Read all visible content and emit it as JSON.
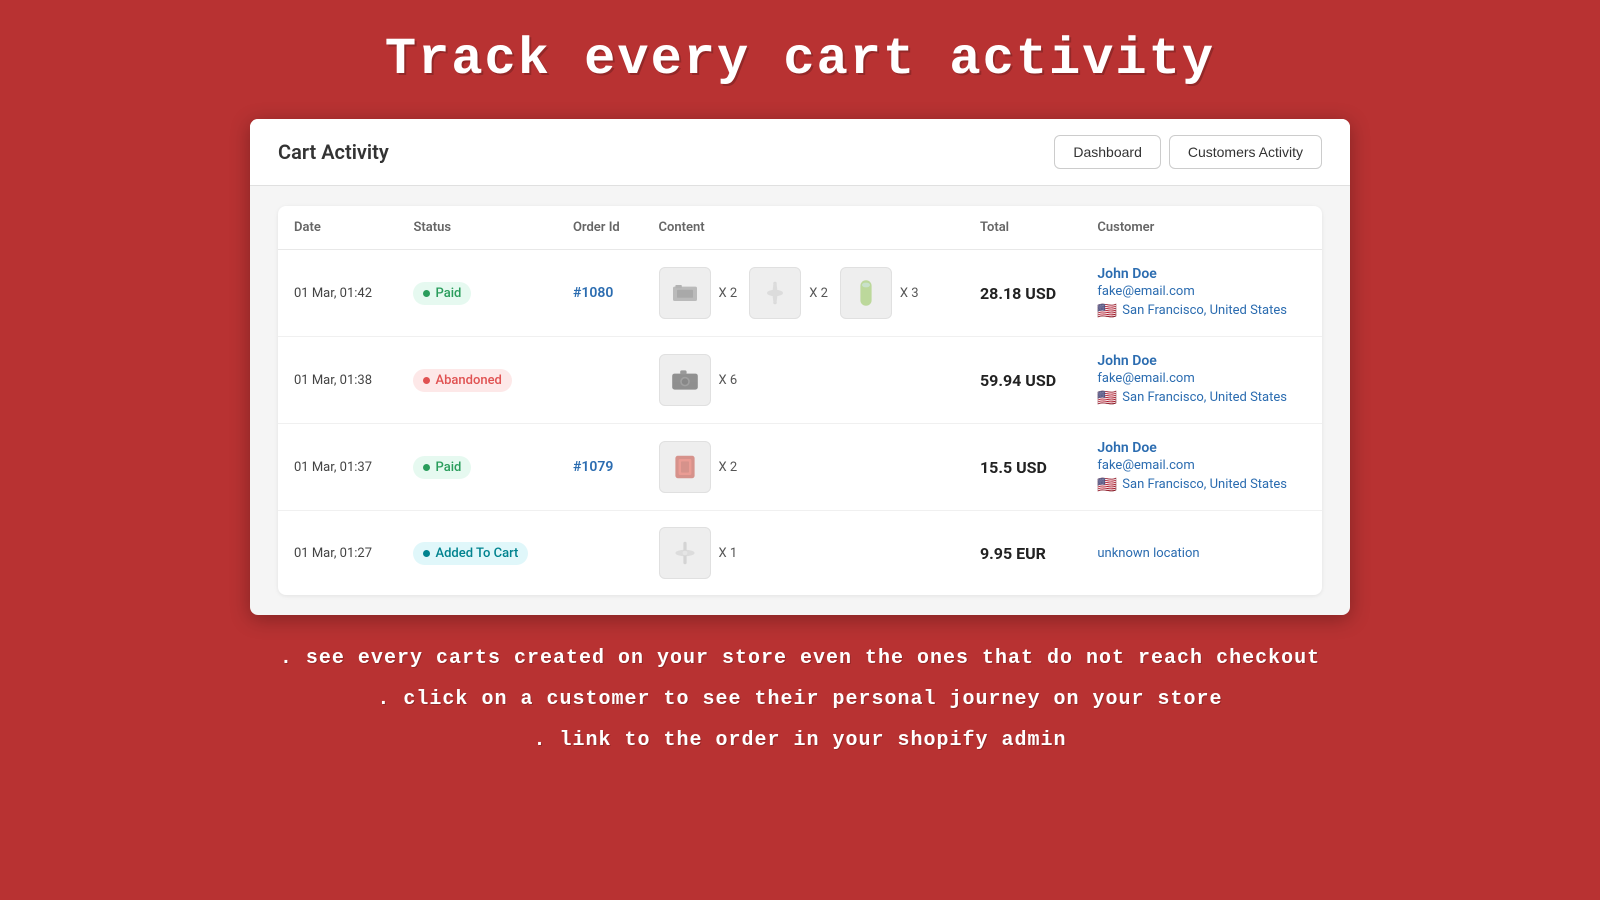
{
  "hero": {
    "title": "Track every cart activity"
  },
  "app": {
    "title": "Cart Activity",
    "buttons": {
      "dashboard": "Dashboard",
      "customers_activity": "Customers Activity"
    }
  },
  "table": {
    "columns": [
      "Date",
      "Status",
      "Order Id",
      "Content",
      "Total",
      "Customer"
    ],
    "rows": [
      {
        "id": 1,
        "date": "01 Mar, 01:42",
        "status": "Paid",
        "status_type": "paid",
        "order_id": "#1080",
        "order_link": true,
        "products": [
          {
            "color": "dark-gray",
            "qty": 2
          },
          {
            "color": "light-gray",
            "qty": 2
          },
          {
            "color": "green",
            "qty": 3
          }
        ],
        "total": "28.18 USD",
        "customer": {
          "name": "John Doe",
          "email": "fake@email.com",
          "location": "San Francisco, United States",
          "flag": "🇺🇸",
          "unknown": false
        }
      },
      {
        "id": 2,
        "date": "01 Mar, 01:38",
        "status": "Abandoned",
        "status_type": "abandoned",
        "order_id": null,
        "order_link": false,
        "products": [
          {
            "color": "camera",
            "qty": 6
          }
        ],
        "total": "59.94 USD",
        "customer": {
          "name": "John Doe",
          "email": "fake@email.com",
          "location": "San Francisco, United States",
          "flag": "🇺🇸",
          "unknown": false
        }
      },
      {
        "id": 3,
        "date": "01 Mar, 01:37",
        "status": "Paid",
        "status_type": "paid",
        "order_id": "#1079",
        "order_link": true,
        "products": [
          {
            "color": "red",
            "qty": 2
          }
        ],
        "total": "15.5 USD",
        "customer": {
          "name": "John Doe",
          "email": "fake@email.com",
          "location": "San Francisco, United States",
          "flag": "🇺🇸",
          "unknown": false
        }
      },
      {
        "id": 4,
        "date": "01 Mar, 01:27",
        "status": "Added To Cart",
        "status_type": "cart",
        "order_id": null,
        "order_link": false,
        "products": [
          {
            "color": "silver",
            "qty": 1
          }
        ],
        "total": "9.95 EUR",
        "customer": {
          "name": null,
          "email": null,
          "location": "unknown location",
          "flag": null,
          "unknown": true
        }
      }
    ]
  },
  "footer": {
    "line1": ". see every carts created on your store even the ones that do not reach checkout",
    "line2": ". click on a customer to see their personal journey on your store",
    "line3": ". link to the order in your shopify admin"
  }
}
